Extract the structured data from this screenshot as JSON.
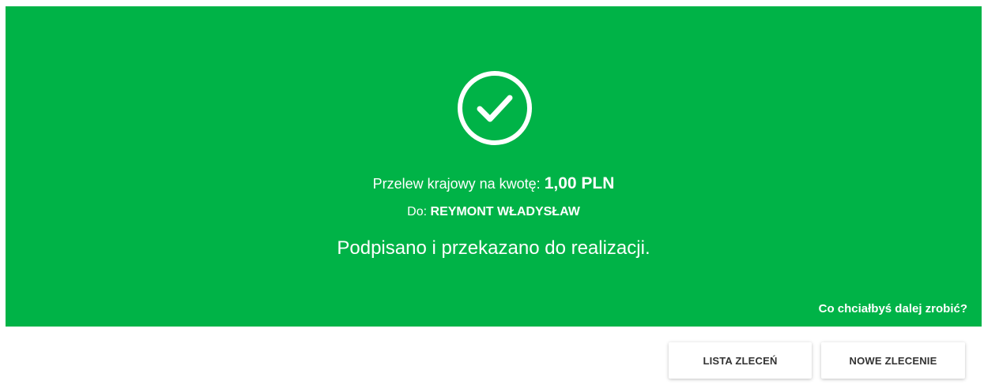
{
  "confirmation": {
    "transfer_prefix": "Przelew krajowy na kwotę:",
    "amount": "1,00 PLN",
    "recipient_prefix": "Do:",
    "recipient_name": "REYMONT WŁADYSŁAW",
    "status": "Podpisano i przekazano do realizacji.",
    "next_prompt": "Co chciałbyś dalej zrobić?",
    "icon": "check-circle-icon"
  },
  "actions": {
    "list_label": "LISTA ZLECEŃ",
    "new_label": "NOWE ZLECENIE"
  },
  "colors": {
    "success_green": "#00b347",
    "text_on_green": "#ffffff",
    "button_bg": "#ffffff",
    "button_text": "#333333"
  }
}
